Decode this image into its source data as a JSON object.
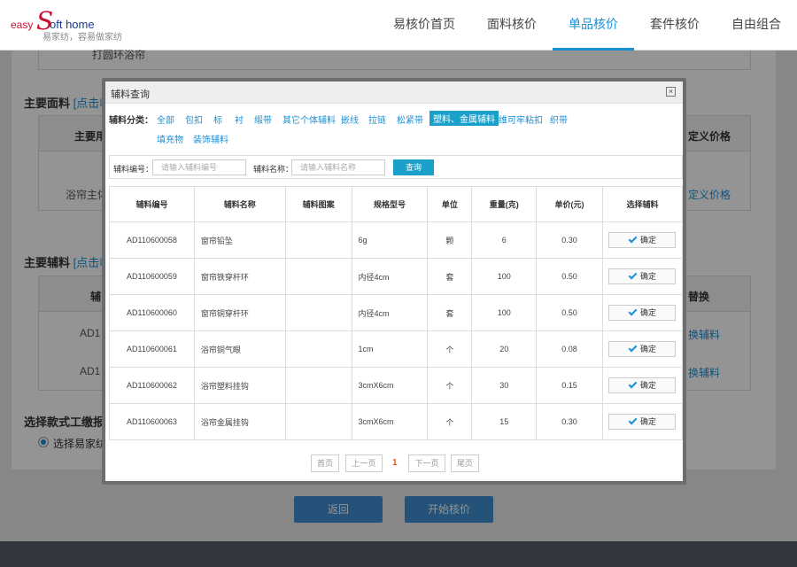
{
  "header": {
    "logo_easy": "easy",
    "logo_s": "S",
    "logo_soft": "oft home",
    "slogan": "易家纺，容易做家纺",
    "nav": [
      "易核价首页",
      "面料核价",
      "单品核价",
      "套件核价",
      "自由组合"
    ],
    "active_nav": 2
  },
  "background": {
    "top_row_text": "打圆环浴帘",
    "main_fabric_title": "主要面料",
    "main_fabric_link": "[点击收",
    "main_fabric_col1": "主要用",
    "main_fabric_col_last": "定义价格",
    "main_fabric_row1": "浴帘主体",
    "main_fabric_row1_link": "定义价格",
    "main_acc_title": "主要辅料",
    "main_acc_link": "[点击收",
    "main_acc_col1": "辅",
    "main_acc_col_last": "替换",
    "main_acc_rows": [
      {
        "code": "AD1",
        "link": "换辅料"
      },
      {
        "code": "AD1",
        "link": "换辅料"
      }
    ],
    "style_title": "选择款式工缴报价",
    "radio_label": "选择易家纺",
    "back_button": "返回",
    "start_button": "开始核价"
  },
  "modal": {
    "title": "辅料查询",
    "close": "×",
    "category_label": "辅料分类：",
    "categories": [
      "全部",
      "包扣",
      "标",
      "衬",
      "缎带",
      "其它个体辅料",
      "嵌线",
      "拉链",
      "松紧带",
      "塑料、金属辅料",
      "维可牢粘扣",
      "织带",
      "填充物",
      "装饰辅料"
    ],
    "active_category": 9,
    "search": {
      "code_label": "辅料编号：",
      "code_placeholder": "请输入辅料编号",
      "name_label": "辅料名称：",
      "name_placeholder": "请输入辅料名称",
      "button": "查询"
    },
    "columns": [
      "辅料编号",
      "辅料名称",
      "辅料图案",
      "规格型号",
      "单位",
      "重量(克)",
      "单价(元)",
      "选择辅料"
    ],
    "rows": [
      {
        "code": "AD110600058",
        "name": "窗帘铅坠",
        "pattern": "",
        "spec": "6g",
        "unit": "颗",
        "weight": "6",
        "price": "0.30",
        "action": "确定"
      },
      {
        "code": "AD110600059",
        "name": "窗帘铁穿杆环",
        "pattern": "",
        "spec": "内径4cm",
        "unit": "套",
        "weight": "100",
        "price": "0.50",
        "action": "确定"
      },
      {
        "code": "AD110600060",
        "name": "窗帘铜穿杆环",
        "pattern": "",
        "spec": "内径4cm",
        "unit": "套",
        "weight": "100",
        "price": "0.50",
        "action": "确定"
      },
      {
        "code": "AD110600061",
        "name": "浴帘铜气眼",
        "pattern": "",
        "spec": "1cm",
        "unit": "个",
        "weight": "20",
        "price": "0.08",
        "action": "确定"
      },
      {
        "code": "AD110600062",
        "name": "浴帘塑料挂钩",
        "pattern": "",
        "spec": "3cmX6cm",
        "unit": "个",
        "weight": "30",
        "price": "0.15",
        "action": "确定"
      },
      {
        "code": "AD110600063",
        "name": "浴帘金属挂钩",
        "pattern": "",
        "spec": "3cmX6cm",
        "unit": "个",
        "weight": "15",
        "price": "0.30",
        "action": "确定"
      }
    ],
    "pager": {
      "first": "首页",
      "prev": "上一页",
      "current": "1",
      "next": "下一页",
      "last": "尾页"
    }
  },
  "colors": {
    "accent": "#1a8fd6",
    "category_active_bg": "#1ba1c9",
    "primary_button": "#3e8ed0",
    "footer": "#33363d",
    "pager_current": "#e8561a"
  }
}
